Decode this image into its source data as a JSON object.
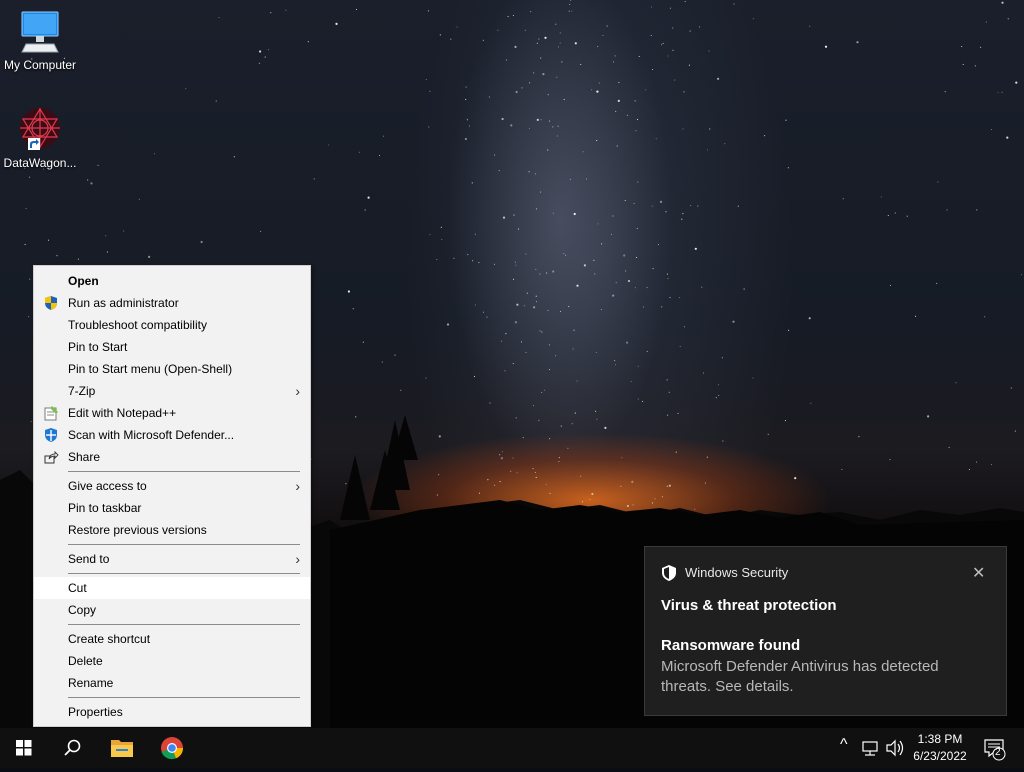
{
  "desktop": {
    "icons": [
      {
        "label": "My Computer",
        "icon": "computer-icon"
      },
      {
        "label": "DataWagon...",
        "icon": "datawagon-shortcut-icon"
      }
    ]
  },
  "context_menu": {
    "groups": [
      [
        {
          "label": "Open",
          "bold": true
        },
        {
          "label": "Run as administrator",
          "icon": "uac-shield-icon"
        },
        {
          "label": "Troubleshoot compatibility"
        },
        {
          "label": "Pin to Start"
        },
        {
          "label": "Pin to Start menu (Open-Shell)"
        },
        {
          "label": "7-Zip",
          "submenu": true
        },
        {
          "label": "Edit with Notepad++",
          "icon": "notepad-plus-plus-icon"
        },
        {
          "label": "Scan with Microsoft Defender...",
          "icon": "defender-icon"
        },
        {
          "label": "Share",
          "icon": "share-icon"
        }
      ],
      [
        {
          "label": "Give access to",
          "submenu": true
        },
        {
          "label": "Pin to taskbar"
        },
        {
          "label": "Restore previous versions"
        }
      ],
      [
        {
          "label": "Send to",
          "submenu": true
        }
      ],
      [
        {
          "label": "Cut",
          "highlighted": true
        },
        {
          "label": "Copy"
        }
      ],
      [
        {
          "label": "Create shortcut"
        },
        {
          "label": "Delete"
        },
        {
          "label": "Rename"
        }
      ],
      [
        {
          "label": "Properties"
        }
      ]
    ],
    "submenu_arrow": "›"
  },
  "toast": {
    "app_name": "Windows Security",
    "close_glyph": "✕",
    "title": "Virus & threat protection",
    "subtitle": "Ransomware found",
    "body": "Microsoft Defender Antivirus has detected threats.  See details."
  },
  "taskbar": {
    "time": "1:38 PM",
    "date": "6/23/2022",
    "notification_count": "2",
    "chevron": "^",
    "accent": "#ffffff"
  }
}
